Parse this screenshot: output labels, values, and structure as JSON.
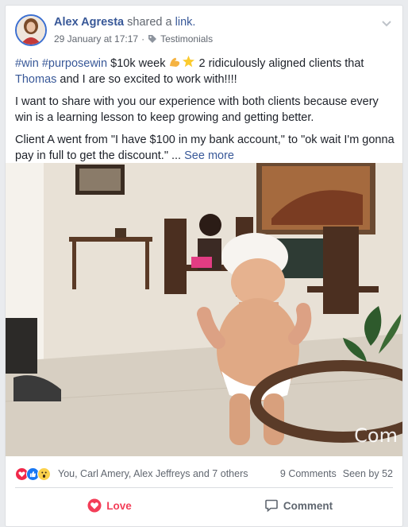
{
  "post": {
    "author": "Alex Agresta",
    "shared_text": "shared a",
    "link_text": "link.",
    "timestamp": "29 January at 17:17",
    "separator": "·",
    "category": "Testimonials"
  },
  "text": {
    "hashtag1": "#win",
    "hashtag2": "#purposewin",
    "line1_rest": "$10k week",
    "line1_after_emoji": "2 ridiculously aligned clients that",
    "mention": "Thomas",
    "line2_rest": "and I are so excited to work with!!!!",
    "para2": "I want to share with you our experience with both clients because every win is a learning lesson to keep growing and getting better.",
    "para3": "Client A went from \"I have $100 in my bank account,\" to \"ok wait I'm gonna pay in full to get the discount.\" ...",
    "see_more": "See more"
  },
  "media": {
    "watermark": "Com"
  },
  "reactions": {
    "names": "You, Carl Amery, Alex Jeffreys and 7 others",
    "comments": "9 Comments",
    "seen": "Seen by 52"
  },
  "actions": {
    "love": "Love",
    "comment": "Comment"
  },
  "colors": {
    "link": "#385898",
    "love": "#f33e58",
    "like": "#1877f2"
  }
}
